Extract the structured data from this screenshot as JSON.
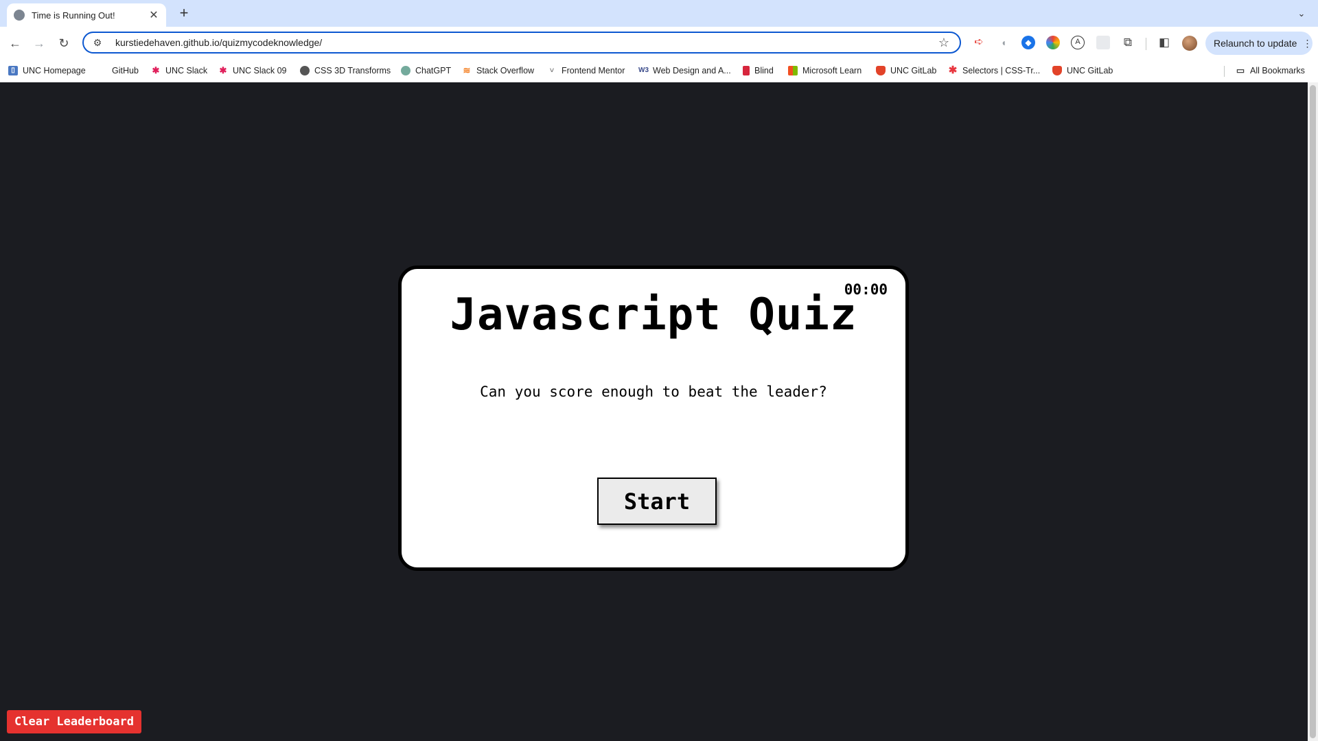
{
  "browser": {
    "tab": {
      "title": "Time is Running Out!"
    },
    "address_bar": {
      "url": "kurstiedehaven.github.io/quizmycodeknowledge/"
    },
    "relaunch_label": "Relaunch to update",
    "bookmarks": [
      {
        "label": "UNC Homepage",
        "icon": "document-icon",
        "color": "#4a78c2"
      },
      {
        "label": "GitHub",
        "icon": "github-icon",
        "color": "#ffffff"
      },
      {
        "label": "UNC Slack",
        "icon": "slack-icon",
        "color": "#e01e5a"
      },
      {
        "label": "UNC Slack 09",
        "icon": "slack-icon",
        "color": "#e01e5a"
      },
      {
        "label": "CSS 3D Transforms",
        "icon": "globe-icon",
        "color": "#555555"
      },
      {
        "label": "ChatGPT",
        "icon": "chatgpt-icon",
        "color": "#74aa9c"
      },
      {
        "label": "Stack Overflow",
        "icon": "stackoverflow-icon",
        "color": "#f48024"
      },
      {
        "label": "Frontend Mentor",
        "icon": "frontend-mentor-icon",
        "color": "#888888"
      },
      {
        "label": "Web Design and A...",
        "icon": "w3-icon",
        "color": "#3a4a8a"
      },
      {
        "label": "Blind",
        "icon": "blind-icon",
        "color": "#d7263d"
      },
      {
        "label": "Microsoft Learn",
        "icon": "microsoft-icon",
        "color": "#f25022"
      },
      {
        "label": "UNC GitLab",
        "icon": "gitlab-icon",
        "color": "#e24329"
      },
      {
        "label": "Selectors | CSS-Tr...",
        "icon": "asterisk-icon",
        "color": "#e8363f"
      },
      {
        "label": "UNC GitLab",
        "icon": "gitlab-icon",
        "color": "#e24329"
      }
    ],
    "all_bookmarks_label": "All Bookmarks"
  },
  "quiz": {
    "timer": "00:00",
    "title": "Javascript Quiz",
    "prompt": "Can you score enough to beat the leader?",
    "start_label": "Start"
  },
  "leaderboard": {
    "clear_label": "Clear Leaderboard"
  }
}
